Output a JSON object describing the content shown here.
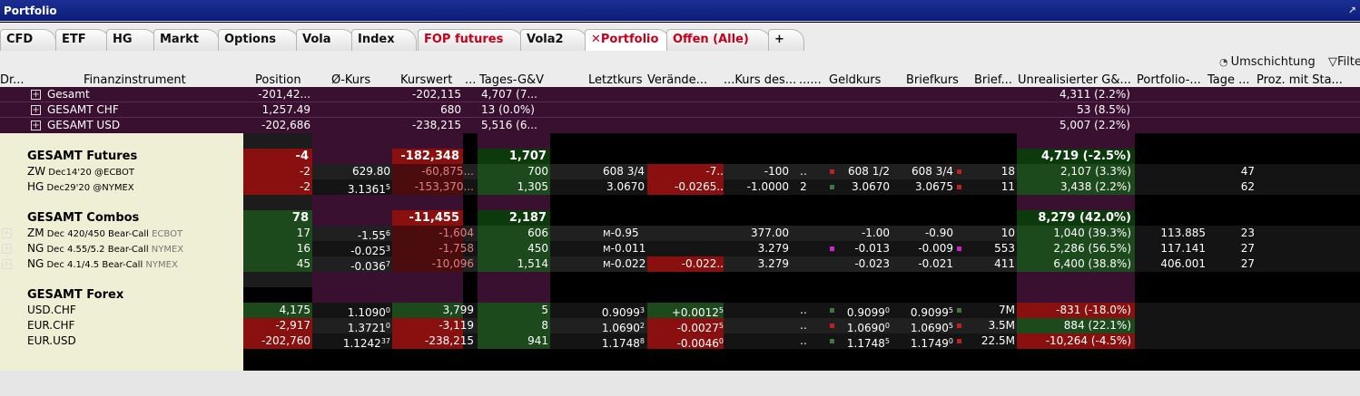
{
  "window": {
    "title": "Portfolio"
  },
  "tabs": [
    {
      "label": "CFD",
      "red": false,
      "closable": false,
      "active": false
    },
    {
      "label": "ETF",
      "red": false,
      "closable": false,
      "active": false
    },
    {
      "label": "HG",
      "red": false,
      "closable": false,
      "active": false
    },
    {
      "label": "Markt",
      "red": false,
      "closable": false,
      "active": false
    },
    {
      "label": "Options",
      "red": false,
      "closable": false,
      "active": false
    },
    {
      "label": "Vola",
      "red": false,
      "closable": false,
      "active": false
    },
    {
      "label": "Index",
      "red": false,
      "closable": false,
      "active": false
    },
    {
      "label": "FOP futures",
      "red": true,
      "closable": false,
      "active": false
    },
    {
      "label": "Vola2",
      "red": false,
      "closable": false,
      "active": false
    },
    {
      "label": "Portfolio",
      "red": true,
      "closable": true,
      "active": true
    },
    {
      "label": "Offen (Alle)",
      "red": true,
      "closable": false,
      "active": false
    },
    {
      "label": "+",
      "red": false,
      "closable": false,
      "active": false
    }
  ],
  "toolbar": {
    "rebalance_label": "Umschichtung",
    "filter_label": "Filte"
  },
  "icons": {
    "rebalance": "gauge-icon",
    "filter": "funnel-icon",
    "expand": "plus-box-icon",
    "pin": "pin-icon"
  },
  "columns": [
    "Dr...",
    "Finanzinstrument",
    "Position",
    "Ø-Kurs",
    "Kurswert",
    "...",
    "Tages-G&V",
    "Letztkurs",
    "Verände...",
    "...Kurs des...",
    "......",
    "Geldkurs",
    "Briefkurs",
    "Brief...",
    "Unrealisierter G&...",
    "Portfolio-...",
    "Tage ...",
    "Proz. mit Sta..."
  ],
  "colors": {
    "summary_bg": "#3a1030",
    "block_light": "#efefd6",
    "row_dark": "#1c1c1c",
    "row_black": "#000000",
    "green": "#1d4a1d",
    "green_bright": "#0d3a0d",
    "red": "#8a1010",
    "red_dark": "#4a0c0c",
    "maroon": "#3a1030"
  },
  "rows": [
    {
      "type": "summary",
      "expand": true,
      "name": "Gesamt",
      "position": "-201,42...",
      "marketValue": "-202,115",
      "dailyPnl": "4,707 (7...",
      "unrealized": "4,311 (2.2%)"
    },
    {
      "type": "summary",
      "expand": true,
      "name": "GESAMT   CHF",
      "position": "1,257.49",
      "marketValue": "680",
      "dailyPnl": "13 (0.0%)",
      "unrealized": "53 (8.5%)"
    },
    {
      "type": "summary",
      "expand": true,
      "name": "GESAMT   USD",
      "position": "-202,686",
      "marketValue": "-238,215",
      "dailyPnl": "5,516 (6...",
      "unrealized": "5,007 (2.2%)"
    },
    {
      "type": "spacer"
    },
    {
      "type": "group",
      "name": "GESAMT Futures",
      "position": "-4",
      "posColor": "red",
      "marketValue": "-182,348",
      "mvColor": "red",
      "dailyPnl": "1,707",
      "dpColor": "green",
      "unrealized": "4,719 (-2.5%)",
      "urColor": "green"
    },
    {
      "type": "data",
      "name": "ZW",
      "detail": "Dec14'20 @ECBOT",
      "exchange": "",
      "position": "-2",
      "posColor": "red",
      "avgPrice": "629.80",
      "marketValue": "-60,875",
      "mvMore": "...",
      "dailyPnl": "700",
      "last": "608 3/4",
      "change": "-7",
      "changeMore": "..",
      "changeColor": "red",
      "pricePrev": "-100",
      "col11": "..",
      "col11b": "",
      "bid": "608 1/2",
      "bidDot": "#c02020",
      "ask": "608 3/4",
      "askDot": "#c02020",
      "askSize": "18",
      "unrealized": "2,107 (3.3%)",
      "urColor": "green",
      "portfolio": "",
      "days": "47",
      "pct": ""
    },
    {
      "type": "data",
      "name": "HG",
      "detail": "Dec29'20 @NYMEX",
      "exchange": "",
      "position": "-2",
      "posColor": "red",
      "avgPrice": "3.1361",
      "avgSup": "5",
      "marketValue": "-153,370",
      "mvMore": "...",
      "dailyPnl": "1,305",
      "last": "3.0670",
      "change": "-0.0265",
      "changeMore": "..",
      "changeColor": "red",
      "pricePrev": "-1.0000",
      "col11": "2",
      "col11b": "",
      "bid": "3.0670",
      "bidDot": "#3c7a3c",
      "ask": "3.0675",
      "askDot": "#c02020",
      "askSize": "11",
      "unrealized": "3,438 (2.2%)",
      "urColor": "green",
      "portfolio": "",
      "days": "62",
      "pct": ""
    },
    {
      "type": "spacer"
    },
    {
      "type": "group",
      "name": "GESAMT Combos",
      "position": "78",
      "posColor": "green",
      "marketValue": "-11,455",
      "mvColor": "red",
      "dailyPnl": "2,187",
      "dpColor": "green",
      "unrealized": "8,279 (42.0%)",
      "urColor": "green"
    },
    {
      "type": "data",
      "expand": true,
      "name": "ZM",
      "detail": "Dec 420/450 Bear-Call",
      "exchange": "ECBOT",
      "position": "17",
      "posColor": "green",
      "avgPrice": "-1.55",
      "avgSup": "6",
      "marketValue": "-1,604",
      "mvMore": "",
      "dailyPnl": "606",
      "last": "-0.95",
      "lastPrefix": "M",
      "change": "",
      "changeMore": "",
      "changeColor": "none",
      "pricePrev": "377.00",
      "col11": "",
      "col11b": "",
      "bid": "-1.00",
      "bidDot": "",
      "ask": "-0.90",
      "askDot": "",
      "askSize": "10",
      "unrealized": "1,040 (39.3%)",
      "urColor": "green",
      "portfolio": "113.885",
      "days": "23",
      "pct": ""
    },
    {
      "type": "data",
      "expand": true,
      "name": "NG",
      "detail": "Dec 4.55/5.2 Bear-Call",
      "exchange": "NYMEX",
      "position": "16",
      "posColor": "green",
      "avgPrice": "-0.025",
      "avgSup": "3",
      "marketValue": "-1,758",
      "mvMore": "",
      "dailyPnl": "450",
      "last": "-0.011",
      "lastPrefix": "M",
      "change": "",
      "changeMore": "",
      "changeColor": "none",
      "pricePrev": "3.279",
      "col11": "",
      "col11b": "",
      "bid": "-0.013",
      "bidDot": "#d020d0",
      "ask": "-0.009",
      "askDot": "#d020d0",
      "askSize": "553",
      "unrealized": "2,286 (56.5%)",
      "urColor": "green",
      "portfolio": "117.141",
      "days": "27",
      "pct": ""
    },
    {
      "type": "data",
      "expand": true,
      "name": "NG",
      "detail": "Dec 4.1/4.5 Bear-Call",
      "exchange": "NYMEX",
      "position": "45",
      "posColor": "green",
      "avgPrice": "-0.036",
      "avgSup": "7",
      "marketValue": "-10,096",
      "mvMore": "",
      "dailyPnl": "1,514",
      "last": "-0.022",
      "lastPrefix": "M",
      "change": "-0.022",
      "changeMore": "..",
      "changeColor": "red",
      "pricePrev": "3.279",
      "col11": "",
      "col11b": "",
      "bid": "-0.023",
      "bidDot": "",
      "ask": "-0.021",
      "askDot": "",
      "askSize": "411",
      "unrealized": "6,400 (38.8%)",
      "urColor": "green",
      "portfolio": "406.001",
      "days": "27",
      "pct": ""
    },
    {
      "type": "spacer"
    },
    {
      "type": "group",
      "name": "GESAMT Forex",
      "position": "",
      "posColor": "none",
      "marketValue": "",
      "mvColor": "none",
      "dailyPnl": "",
      "dpColor": "none",
      "unrealized": "",
      "urColor": "none"
    },
    {
      "type": "data",
      "name": "USD.CHF",
      "detail": "",
      "exchange": "",
      "position": "4,175",
      "posColor": "green",
      "avgPrice": "1.1090",
      "avgSup": "0",
      "marketValue": "3,799",
      "mvMore": "",
      "mvColorOverride": "green",
      "dailyPnl": "5",
      "last": "0.9099",
      "lastSup": "3",
      "change": "+0.0012",
      "changeSup": "5",
      "changeMore": "",
      "changeColor": "green",
      "pricePrev": "",
      "col11": "..",
      "col11b": "",
      "bid": "0.9099",
      "bidSup": "0",
      "bidDot": "#3c7a3c",
      "ask": "0.9099",
      "askSup": "5",
      "askDot": "#3c7a3c",
      "askSize": "7M",
      "unrealized": "-831 (-18.0%)",
      "urColor": "red",
      "portfolio": "",
      "days": "",
      "pct": ""
    },
    {
      "type": "data",
      "name": "EUR.CHF",
      "detail": "",
      "exchange": "",
      "position": "-2,917",
      "posColor": "red",
      "avgPrice": "1.3721",
      "avgSup": "0",
      "marketValue": "-3,119",
      "mvMore": "",
      "mvColorOverride": "red",
      "dailyPnl": "8",
      "last": "1.0690",
      "lastSup": "2",
      "change": "-0.0027",
      "changeSup": "5",
      "changeMore": "",
      "changeColor": "red",
      "pricePrev": "",
      "col11": "..",
      "col11b": "",
      "bid": "1.0690",
      "bidSup": "0",
      "bidDot": "#c02020",
      "ask": "1.0690",
      "askSup": "5",
      "askDot": "#c02020",
      "askSize": "3.5M",
      "unrealized": "884 (22.1%)",
      "urColor": "green",
      "portfolio": "",
      "days": "",
      "pct": ""
    },
    {
      "type": "data",
      "name": "EUR.USD",
      "detail": "",
      "exchange": "",
      "position": "-202,760",
      "posColor": "red",
      "avgPrice": "1.1242",
      "avgSup": "37",
      "marketValue": "-238,215",
      "mvMore": "",
      "mvColorOverride": "red",
      "dailyPnl": "941",
      "last": "1.1748",
      "lastSup": "8",
      "change": "-0.0046",
      "changeSup": "0",
      "changeMore": "",
      "changeColor": "red",
      "pricePrev": "",
      "col11": "..",
      "col11b": "",
      "bid": "1.1748",
      "bidSup": "5",
      "bidDot": "#3c7a3c",
      "ask": "1.1749",
      "askSup": "0",
      "askDot": "#c02020",
      "askSize": "22.5M",
      "unrealized": "-10,264 (-4.5%)",
      "urColor": "red",
      "portfolio": "",
      "days": "",
      "pct": ""
    }
  ]
}
